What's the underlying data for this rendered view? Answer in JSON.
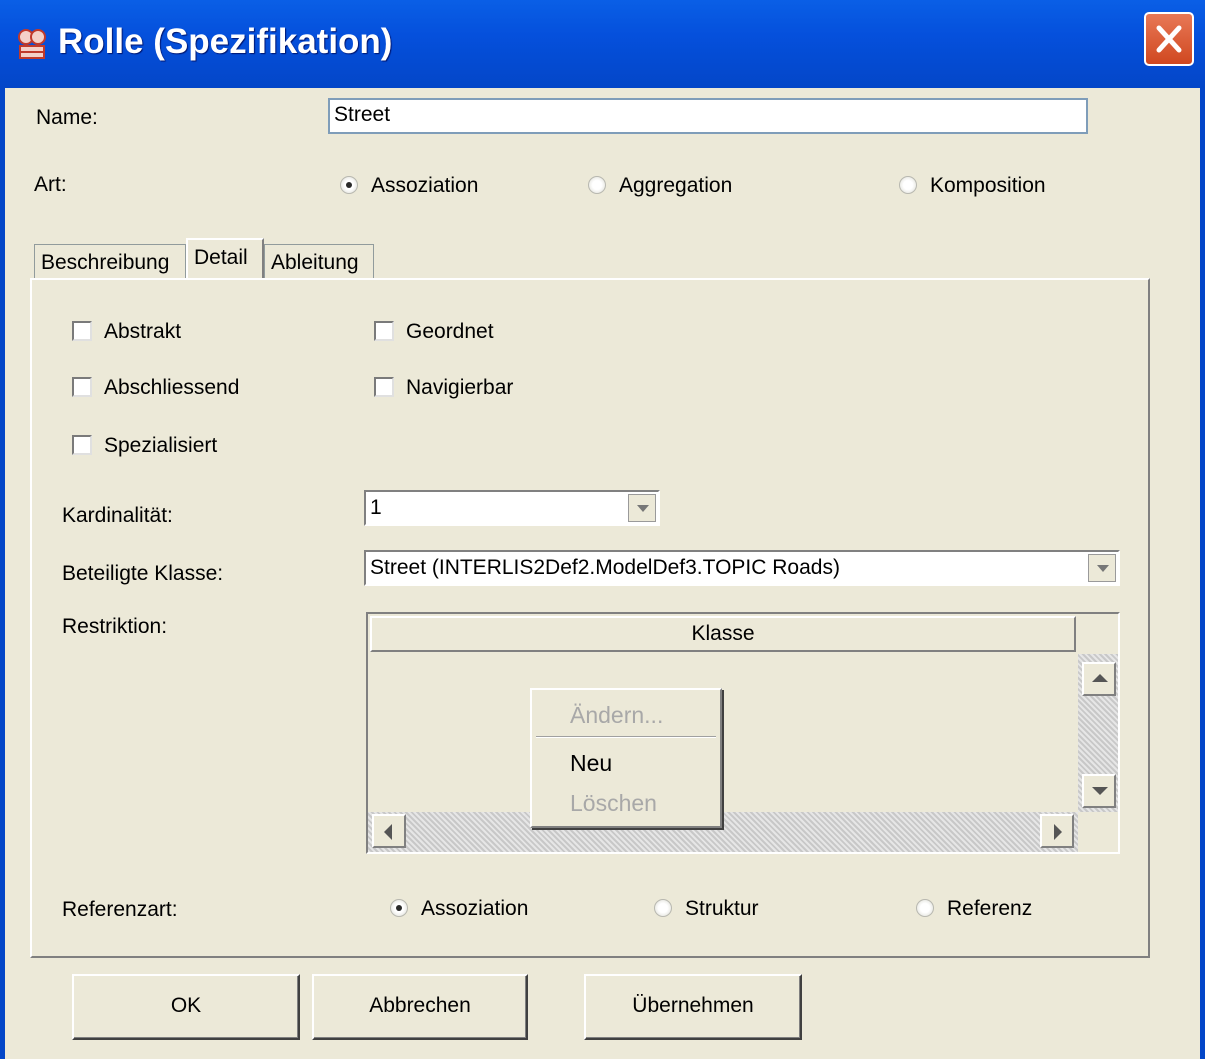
{
  "window": {
    "title": "Rolle (Spezifikation)"
  },
  "form": {
    "name_label": "Name:",
    "name_value": "Street",
    "art_label": "Art:",
    "art_options": [
      "Assoziation",
      "Aggregation",
      "Komposition"
    ],
    "art_selected": "Assoziation"
  },
  "tabs": [
    "Beschreibung",
    "Detail",
    "Ableitung"
  ],
  "active_tab": "Detail",
  "detail": {
    "checkboxes": [
      {
        "label": "Abstrakt",
        "checked": false
      },
      {
        "label": "Geordnet",
        "checked": false
      },
      {
        "label": "Abschliessend",
        "checked": false
      },
      {
        "label": "Navigierbar",
        "checked": false
      },
      {
        "label": "Spezialisiert",
        "checked": false
      }
    ],
    "kardinalitaet_label": "Kardinalität:",
    "kardinalitaet_value": "1",
    "klasse_label": "Beteiligte Klasse:",
    "klasse_value": "Street (INTERLIS2Def2.ModelDef3.TOPIC Roads)",
    "restriktion_label": "Restriktion:",
    "restriktion_column": "Klasse",
    "context_menu": [
      {
        "label": "Ändern...",
        "enabled": false
      },
      {
        "label": "Neu",
        "enabled": true
      },
      {
        "label": "Löschen",
        "enabled": false
      }
    ],
    "referenzart_label": "Referenzart:",
    "referenzart_options": [
      "Assoziation",
      "Struktur",
      "Referenz"
    ],
    "referenzart_selected": "Assoziation"
  },
  "buttons": {
    "ok": "OK",
    "cancel": "Abbrechen",
    "apply": "Übernehmen"
  }
}
